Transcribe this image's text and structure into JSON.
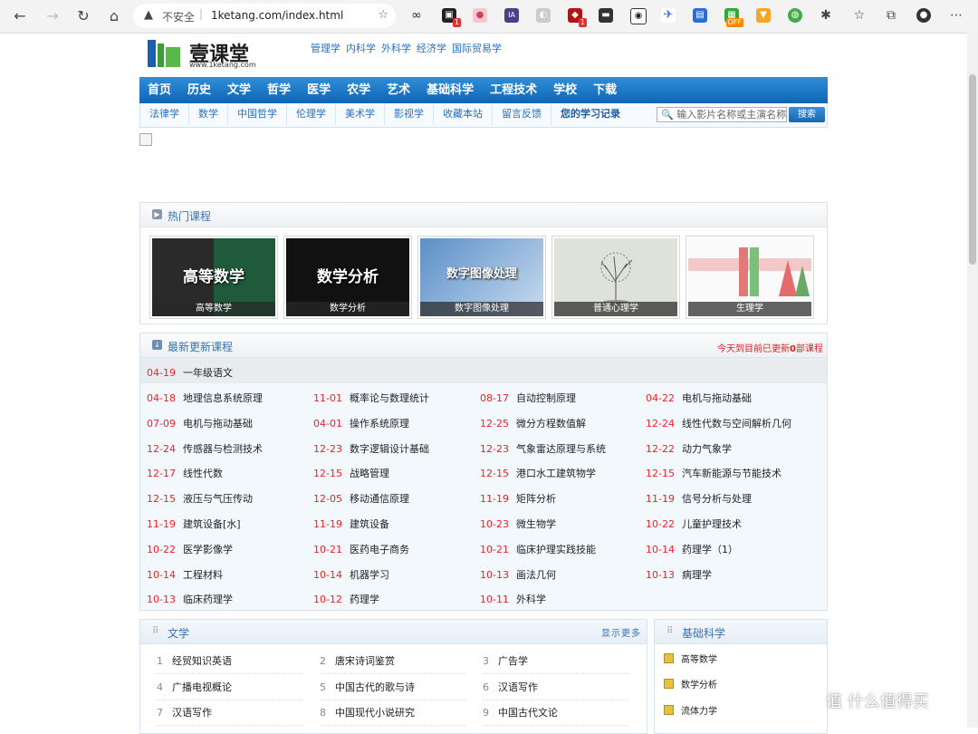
{
  "browser": {
    "security_label": "不安全",
    "url": "1ketang.com/index.html",
    "extension_badges": [
      "1",
      "1",
      "OFF"
    ]
  },
  "logo": {
    "text": "壹课堂",
    "sub": "www.1ketang.com"
  },
  "top_links": [
    "管理学",
    "内科学",
    "外科学",
    "经济学",
    "国际贸易学"
  ],
  "main_nav": [
    "首页",
    "历史",
    "文学",
    "哲学",
    "医学",
    "农学",
    "艺术",
    "基础科学",
    "工程技术",
    "学校",
    "下载"
  ],
  "sub_nav": [
    "法律学",
    "数学",
    "中国哲学",
    "伦理学",
    "美术学",
    "影视学",
    "收藏本站",
    "留言反馈",
    "您的学习记录"
  ],
  "search": {
    "placeholder": "输入影片名称或主演名称",
    "button": "搜索"
  },
  "hot": {
    "title": "热门课程",
    "courses": [
      {
        "caption": "高等数学",
        "big": "高等数学"
      },
      {
        "caption": "数学分析",
        "big": "数学分析"
      },
      {
        "caption": "数字图像处理",
        "big": "数字图像处理"
      },
      {
        "caption": "普通心理学",
        "big": ""
      },
      {
        "caption": "生理学",
        "big": ""
      }
    ]
  },
  "latest": {
    "title": "最新更新课程",
    "note_prefix": "今天到目前已更新",
    "note_count": "0",
    "note_suffix": "部课程",
    "first": {
      "date": "04-19",
      "title": "一年级语文"
    },
    "items": [
      {
        "date": "04-18",
        "title": "地理信息系统原理"
      },
      {
        "date": "11-01",
        "title": "概率论与数理统计"
      },
      {
        "date": "08-17",
        "title": "自动控制原理"
      },
      {
        "date": "04-22",
        "title": "电机与拖动基础"
      },
      {
        "date": "07-09",
        "title": "电机与拖动基础"
      },
      {
        "date": "04-01",
        "title": "操作系统原理"
      },
      {
        "date": "12-25",
        "title": "微分方程数值解"
      },
      {
        "date": "12-24",
        "title": "线性代数与空间解析几何"
      },
      {
        "date": "12-24",
        "title": "传感器与检测技术"
      },
      {
        "date": "12-23",
        "title": "数字逻辑设计基础"
      },
      {
        "date": "12-23",
        "title": "气象雷达原理与系统"
      },
      {
        "date": "12-22",
        "title": "动力气象学"
      },
      {
        "date": "12-17",
        "title": "线性代数"
      },
      {
        "date": "12-15",
        "title": "战略管理"
      },
      {
        "date": "12-15",
        "title": "港口水工建筑物学"
      },
      {
        "date": "12-15",
        "title": "汽车新能源与节能技术"
      },
      {
        "date": "12-15",
        "title": "液压与气压传动"
      },
      {
        "date": "12-05",
        "title": "移动通信原理"
      },
      {
        "date": "11-19",
        "title": "矩阵分析"
      },
      {
        "date": "11-19",
        "title": "信号分析与处理"
      },
      {
        "date": "11-19",
        "title": "建筑设备[水]"
      },
      {
        "date": "11-19",
        "title": "建筑设备"
      },
      {
        "date": "10-23",
        "title": "微生物学"
      },
      {
        "date": "10-22",
        "title": "儿童护理技术"
      },
      {
        "date": "10-22",
        "title": "医学影像学"
      },
      {
        "date": "10-21",
        "title": "医药电子商务"
      },
      {
        "date": "10-21",
        "title": "临床护理实践技能"
      },
      {
        "date": "10-14",
        "title": "药理学（1）"
      },
      {
        "date": "10-14",
        "title": "工程材料"
      },
      {
        "date": "10-14",
        "title": "机器学习"
      },
      {
        "date": "10-13",
        "title": "画法几何"
      },
      {
        "date": "10-13",
        "title": "病理学"
      },
      {
        "date": "10-13",
        "title": "临床药理学"
      },
      {
        "date": "10-12",
        "title": "药理学"
      },
      {
        "date": "10-11",
        "title": "外科学"
      }
    ]
  },
  "literature": {
    "title": "文学",
    "more": "显示更多",
    "items": [
      {
        "n": "1",
        "t": "经贸知识英语"
      },
      {
        "n": "2",
        "t": "唐宋诗词鉴赏"
      },
      {
        "n": "3",
        "t": "广告学"
      },
      {
        "n": "4",
        "t": "广播电视概论"
      },
      {
        "n": "5",
        "t": "中国古代的歌与诗"
      },
      {
        "n": "6",
        "t": "汉语写作"
      },
      {
        "n": "7",
        "t": "汉语写作"
      },
      {
        "n": "8",
        "t": "中国现代小说研究"
      },
      {
        "n": "9",
        "t": "中国古代文论"
      }
    ]
  },
  "science": {
    "title": "基础科学",
    "items": [
      "高等数学",
      "数学分析",
      "流体力学"
    ]
  },
  "watermark": "值 什么值得买"
}
